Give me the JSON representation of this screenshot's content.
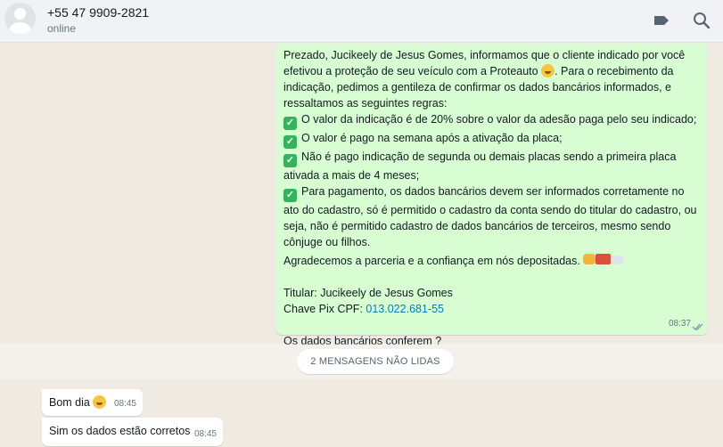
{
  "header": {
    "contact_name": "+55 47 9909-2821",
    "status": "online",
    "icons": [
      "label-icon",
      "search-icon"
    ]
  },
  "messages": {
    "outgoing": {
      "intro": "Prezado, Jucikeely de Jesus Gomes, informamos que o cliente indicado por você efetivou a proteção de seu veículo com a Proteauto",
      "intro_tail": ". Para o recebimento da indicação, pedimos a gentileza de confirmar os dados bancários informados, e ressaltamos as seguintes regras:",
      "rules": [
        "O valor da indicação é de 20% sobre o valor da adesão paga pelo seu indicado;",
        "O valor é pago na semana após a ativação da placa;",
        "Não é pago indicação de segunda ou demais placas sendo a primeira placa ativada a mais de 4 meses;",
        "Para pagamento, os dados bancários devem ser informados corretamente no ato do cadastro, só é permitido o cadastro da conta sendo do titular do cadastro, ou seja, não é permitido cadastro de dados bancários de terceiros, mesmo sendo cônjuge ou filhos."
      ],
      "thanks": "Agradecemos a parceria e a confiança em nós depositadas.",
      "holder_line": "Titular: Jucikeely de Jesus Gomes",
      "pix_label": "Chave Pix CPF:",
      "pix_value": "013.022.681-55",
      "question": "Os dados bancários conferem ?",
      "time": "08:37"
    },
    "unread_banner": "2 MENSAGENS NÃO LIDAS",
    "incoming": [
      {
        "text": "Bom dia",
        "time": "08:45"
      },
      {
        "text": "Sim os dados estão corretos",
        "time": "08:45"
      }
    ]
  },
  "colors": {
    "outgoing_bubble": "#d9fdd3",
    "incoming_bubble": "#ffffff",
    "chat_background": "#efeae2",
    "header_background": "#f0f2f5",
    "link": "#027eb5"
  }
}
